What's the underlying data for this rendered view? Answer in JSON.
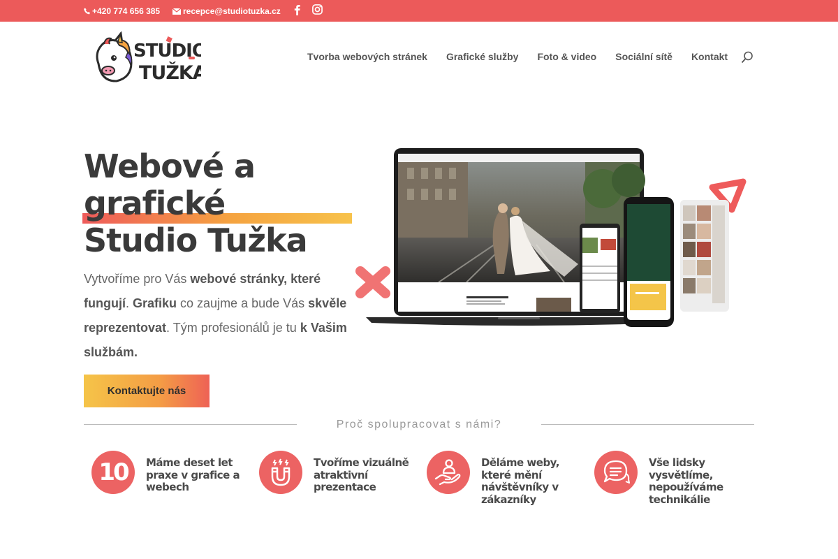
{
  "topbar": {
    "phone": "+420 774 656 385",
    "email": "recepce@studiotuzka.cz",
    "icons": [
      "phone-icon",
      "mail-icon",
      "facebook-icon",
      "instagram-icon"
    ]
  },
  "header": {
    "logo_line1": "STUDIO",
    "logo_line2": "TUŽKA",
    "nav": [
      {
        "label": "Tvorba webových stránek"
      },
      {
        "label": "Grafické služby"
      },
      {
        "label": "Foto & video"
      },
      {
        "label": "Sociální sítě"
      },
      {
        "label": "Kontakt"
      }
    ]
  },
  "hero": {
    "title_line1": "Webové a",
    "title_line2": "grafické",
    "title_line3": "Studio Tužka",
    "text_parts": [
      "Vytvoříme pro Vás ",
      "webové stránky, které fungují",
      ". ",
      "Grafiku",
      " co zaujme a bude Vás ",
      "skvěle reprezentovat",
      ". Tým profesionálů je tu ",
      "k Vašim službám."
    ],
    "cta_label": "Kontaktujte nás"
  },
  "section": {
    "title": "Proč spolupracovat s námi?"
  },
  "features": [
    {
      "icon": "number-ten-icon",
      "number": "10",
      "text": "Máme deset let praxe v grafice a webech"
    },
    {
      "icon": "magnet-icon",
      "text": "Tvoříme vizuálně atraktivní prezentace"
    },
    {
      "icon": "hand-person-icon",
      "text": "Děláme weby, které mění návštěvníky v zákazníky"
    },
    {
      "icon": "chat-bubbles-icon",
      "text": "Vše lidsky vysvětlíme, nepoužíváme technikálie"
    }
  ],
  "colors": {
    "accent": "#ec5a5a",
    "gradient_orange": "#f5a340",
    "gradient_yellow": "#f7c24b",
    "dark_text": "#3a3a3a"
  }
}
